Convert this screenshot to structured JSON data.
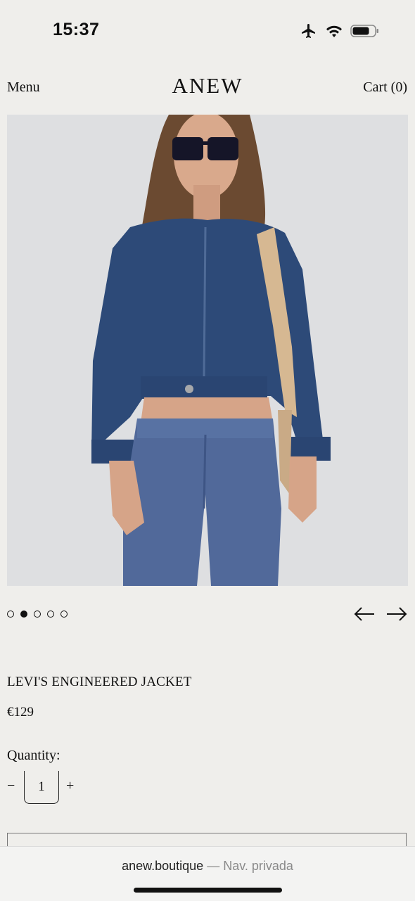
{
  "status_bar": {
    "time": "15:37",
    "icons": [
      "airplane-icon",
      "wifi-icon",
      "battery-icon"
    ]
  },
  "nav": {
    "menu_label": "Menu",
    "logo": "ANEW",
    "cart_label": "Cart (0)"
  },
  "gallery": {
    "image": "product-photo-denim-jacket",
    "slide_count": 5,
    "active_slide": 2,
    "prev_icon": "arrow-left-icon",
    "next_icon": "arrow-right-icon"
  },
  "product": {
    "title": "LEVI'S ENGINEERED JACKET",
    "price": "€129"
  },
  "quantity": {
    "label": "Quantity:",
    "minus": "−",
    "value": "1",
    "plus": "+"
  },
  "browser": {
    "domain": "anew.boutique",
    "separator": " — ",
    "mode": "Nav. privada"
  },
  "colors": {
    "background": "#efeeeb",
    "text": "#111111",
    "photo_background": "#dfdfe0"
  }
}
